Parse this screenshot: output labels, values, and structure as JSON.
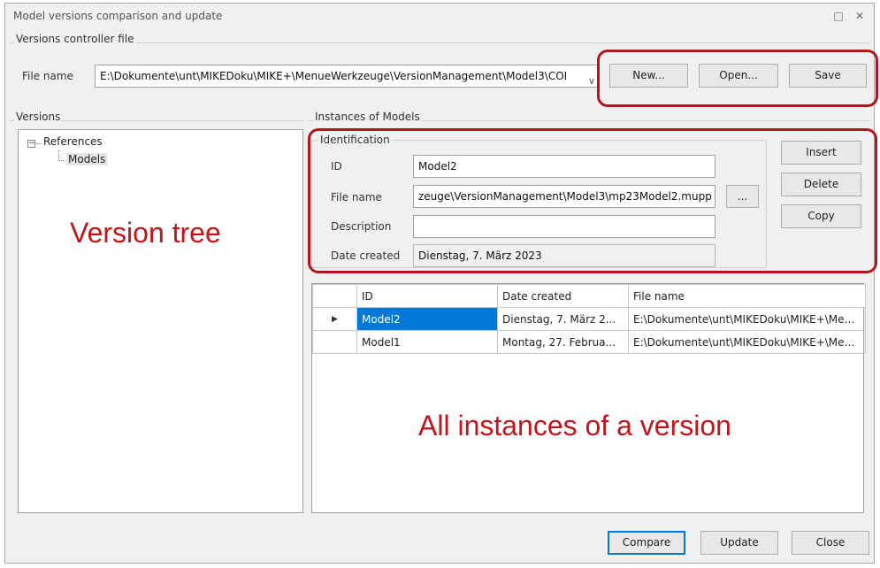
{
  "window": {
    "title": "Model versions comparison and update",
    "maximize_icon": "maximize-icon",
    "close_icon": "close-icon",
    "maximize_glyph": "□",
    "close_glyph": "✕"
  },
  "controller": {
    "group_label": "Versions controller file",
    "file_label": "File name",
    "file_value": "E:\\Dokumente\\unt\\MIKEDoku\\MIKE+\\MenueWerkzeuge\\VersionManagement\\Model3\\COI",
    "dropdown_glyph": "∨",
    "new_label": "New...",
    "open_label": "Open...",
    "save_label": "Save"
  },
  "versions": {
    "group_label": "Versions",
    "expander_glyph": "−",
    "root_label": "References",
    "child_label": "Models"
  },
  "instances": {
    "group_label": "Instances of Models",
    "identification_label": "Identification",
    "id_label": "ID",
    "id_value": "Model2",
    "file_label": "File name",
    "file_value": "zeuge\\VersionManagement\\Model3\\mp23Model2.mupp",
    "browse_label": "...",
    "description_label": "Description",
    "description_value": "",
    "date_label": "Date created",
    "date_value": "Dienstag, 7. März 2023",
    "insert_label": "Insert",
    "delete_label": "Delete",
    "copy_label": "Copy"
  },
  "grid": {
    "columns": [
      "ID",
      "Date created",
      "File name"
    ],
    "rows": [
      {
        "indicator": "▶",
        "id": "Model2",
        "date": "Dienstag, 7. März 2...",
        "file": "E:\\Dokumente\\unt\\MIKEDoku\\MIKE+\\Men..."
      },
      {
        "indicator": "",
        "id": "Model1",
        "date": "Montag, 27. Februa...",
        "file": "E:\\Dokumente\\unt\\MIKEDoku\\MIKE+\\Men..."
      }
    ]
  },
  "footer": {
    "compare_label": "Compare",
    "update_label": "Update",
    "close_label": "Close"
  },
  "annotations": {
    "version_tree": "Version tree",
    "all_instances": "All instances of a version"
  },
  "colors": {
    "highlight": "#b0161c",
    "annotation_text": "#c0151b",
    "selection": "#0078d7"
  }
}
